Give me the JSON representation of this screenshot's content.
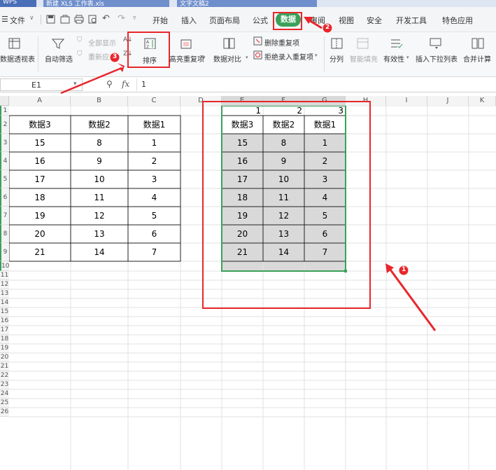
{
  "titlebar": {
    "app": "WPS",
    "file_tab": "新建 XLS 工作表.xls",
    "doc_tab": "文字文稿2"
  },
  "menu": {
    "file": "文件",
    "tabs": [
      "开始",
      "插入",
      "页面布局",
      "公式",
      "数据",
      "审阅",
      "视图",
      "安全",
      "开发工具",
      "特色应用"
    ],
    "active_tab": "数据"
  },
  "ribbon": {
    "pivot": "数据透视表",
    "autofilter": "自动筛选",
    "show_all": "全部显示",
    "reapply": "重新应用",
    "sort": "排序",
    "highlight_dup": "高亮重复项",
    "compare": "数据对比",
    "remove_dup": "删除重复项",
    "reject_dup": "拒绝录入重复项",
    "split": "分列",
    "smart_fill": "智能填充",
    "validity": "有效性",
    "dropdown": "插入下拉列表",
    "merge_calc": "合并计算"
  },
  "formula": {
    "namebox": "E1",
    "fx": "fx",
    "value": "1"
  },
  "columns": [
    "A",
    "B",
    "C",
    "D",
    "E",
    "F",
    "G",
    "H",
    "I",
    "J",
    "K"
  ],
  "rows": [
    "1",
    "2",
    "3",
    "4",
    "5",
    "6",
    "7",
    "8",
    "9",
    "10",
    "11",
    "12",
    "13",
    "14",
    "15",
    "16",
    "17",
    "18",
    "19",
    "20",
    "21",
    "22",
    "23",
    "24",
    "25",
    "26"
  ],
  "table_left": {
    "headers": [
      "数据3",
      "数据2",
      "数据1"
    ],
    "rows": [
      [
        "15",
        "8",
        "1"
      ],
      [
        "16",
        "9",
        "2"
      ],
      [
        "17",
        "10",
        "3"
      ],
      [
        "18",
        "11",
        "4"
      ],
      [
        "19",
        "12",
        "5"
      ],
      [
        "20",
        "13",
        "6"
      ],
      [
        "21",
        "14",
        "7"
      ]
    ]
  },
  "table_right": {
    "top_numbers": [
      "1",
      "2",
      "3"
    ],
    "headers": [
      "数据3",
      "数据2",
      "数据1"
    ],
    "rows": [
      [
        "15",
        "8",
        "1"
      ],
      [
        "16",
        "9",
        "2"
      ],
      [
        "17",
        "10",
        "3"
      ],
      [
        "18",
        "11",
        "4"
      ],
      [
        "19",
        "12",
        "5"
      ],
      [
        "20",
        "13",
        "6"
      ],
      [
        "21",
        "14",
        "7"
      ]
    ]
  },
  "annotations": {
    "badge1": "1",
    "badge2": "2",
    "badge3": "3"
  },
  "colors": {
    "accent_green": "#3aa15b",
    "annotation_red": "#e8262c",
    "selection": "#d9d9d9"
  }
}
